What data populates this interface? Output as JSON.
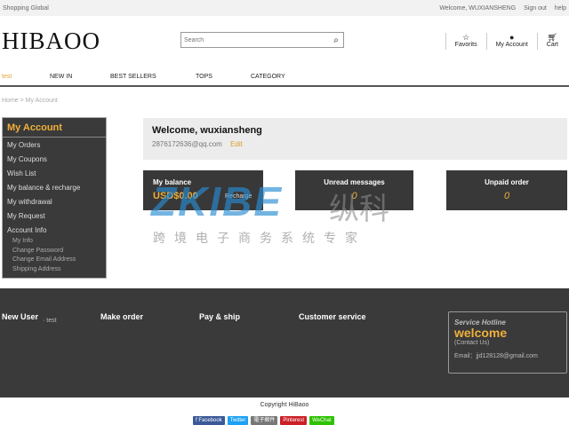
{
  "topbar": {
    "left": "Shopping Global",
    "welcome": "Welcome, WUXIANSHENG",
    "signout": "Sign out",
    "help": "help"
  },
  "header": {
    "logo": "HIBAOO",
    "search_placeholder": "Search",
    "favorites": "Favorits",
    "account": "My Account",
    "cart": "Cart"
  },
  "nav": {
    "items": [
      "test",
      "NEW IN",
      "BEST SELLERS",
      "TOPS",
      "CATEGORY"
    ]
  },
  "breadcrumb": {
    "text": "Home > My Account"
  },
  "sidebar": {
    "title": "My Account",
    "items": [
      "My Orders",
      "My Coupons",
      "Wish List",
      "My balance & recharge",
      "My withdrawal",
      "My Request",
      "Account Info"
    ],
    "subitems": [
      "My Info",
      "Change Password",
      "Change Email Address",
      "Shipping Address"
    ]
  },
  "welcome": {
    "heading": "Welcome, wuxiansheng",
    "email": "2876172636@qq.com",
    "edit": "Edit"
  },
  "cards": {
    "balance_label": "My balance",
    "balance_value": "USD$0.00",
    "recharge": "Recharge",
    "unread_label": "Unread messages",
    "unread_value": "0",
    "unpaid_label": "Unpaid order",
    "unpaid_value": "0"
  },
  "watermark": {
    "brand": "ZKIBE",
    "brand_cn": "纵科",
    "tagline": "跨境电子商务系统专家"
  },
  "footer": {
    "cols": [
      "New User",
      "Make order",
      "Pay & ship",
      "Customer service"
    ],
    "new_user_sub": "test",
    "service_title": "Service Hotline",
    "service_welcome": "welcome",
    "service_contact": "(Contact Us)",
    "service_email": "Email：jjd128128@gmail.com"
  },
  "copyright": "Copyright HiBaoo",
  "shares": [
    {
      "label": "f Facebook",
      "color": "#3b5998"
    },
    {
      "label": "Twitter",
      "color": "#1da1f2"
    },
    {
      "label": "電子郵件",
      "color": "#777777"
    },
    {
      "label": "Pinterest",
      "color": "#cb2027"
    },
    {
      "label": "WeChat",
      "color": "#2dc100"
    }
  ],
  "colors": {
    "accent": "#f0b03a",
    "dark_panel": "#3a3a3a"
  }
}
